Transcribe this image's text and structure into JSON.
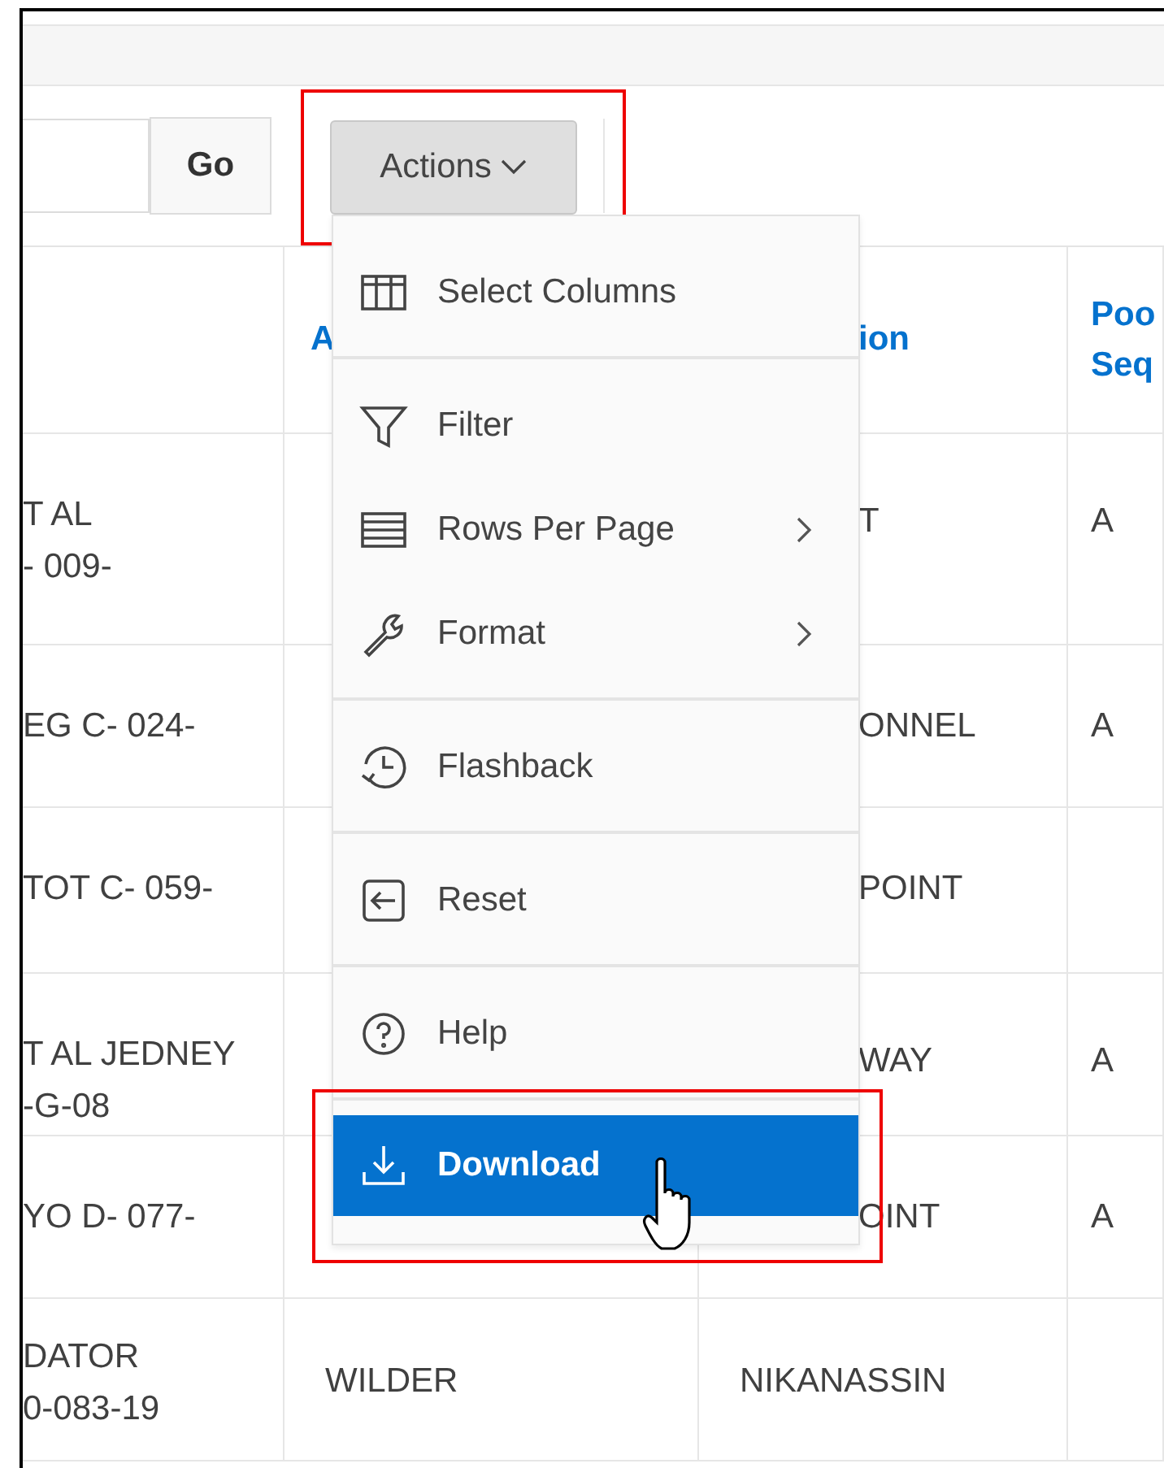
{
  "toolbar": {
    "go_button": "Go",
    "actions_button": "Actions"
  },
  "table": {
    "header": [
      "A",
      "ion",
      "Poo\nSeq"
    ],
    "rows": [
      {
        "cells": [
          "T AL\n- 009-",
          "",
          "T",
          "A"
        ],
        "overlapped": true
      },
      {
        "cells": [
          "EG C- 024-",
          "",
          "ONNEL",
          "A"
        ],
        "overlapped": true
      },
      {
        "cells": [
          "TOT C- 059-",
          "",
          "POINT",
          ""
        ],
        "overlapped": true
      },
      {
        "cells": [
          "T AL JEDNEY\n-G-08",
          "",
          "WAY",
          "A"
        ],
        "overlapped": true
      },
      {
        "cells": [
          "YO D- 077-",
          "",
          "OINT",
          "A"
        ],
        "overlapped": true
      },
      {
        "cells": [
          "DATOR\n0-083-19",
          "WILDER",
          "NIKANASSIN",
          ""
        ],
        "overlapped": false
      }
    ]
  },
  "menu": {
    "items": [
      {
        "label": "Select Columns",
        "submenu": false,
        "selected": false,
        "separator_after": true
      },
      {
        "label": "Filter",
        "submenu": false,
        "selected": false,
        "separator_after": false
      },
      {
        "label": "Rows Per Page",
        "submenu": true,
        "selected": false,
        "separator_after": false
      },
      {
        "label": "Format",
        "submenu": true,
        "selected": false,
        "separator_after": true
      },
      {
        "label": "Flashback",
        "submenu": false,
        "selected": false,
        "separator_after": true
      },
      {
        "label": "Reset",
        "submenu": false,
        "selected": false,
        "separator_after": true
      },
      {
        "label": "Help",
        "submenu": false,
        "selected": false,
        "separator_after": true
      },
      {
        "label": "Download",
        "submenu": false,
        "selected": true,
        "separator_after": false
      }
    ]
  }
}
